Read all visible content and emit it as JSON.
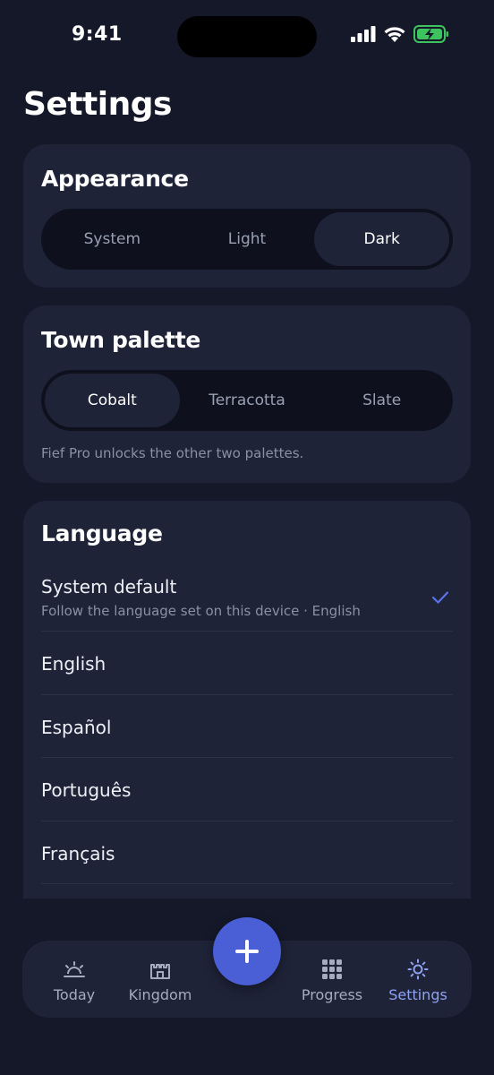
{
  "status": {
    "time": "9:41"
  },
  "page": {
    "title": "Settings"
  },
  "appearance": {
    "title": "Appearance",
    "options": [
      "System",
      "Light",
      "Dark"
    ],
    "selected": "Dark"
  },
  "palette": {
    "title": "Town palette",
    "options": [
      "Cobalt",
      "Terracotta",
      "Slate"
    ],
    "selected": "Cobalt",
    "hint": "Fief Pro unlocks the other two palettes."
  },
  "language": {
    "title": "Language",
    "items": [
      {
        "label": "System default",
        "sublabel": "Follow the language set on this device · English",
        "selected": true
      },
      {
        "label": "English"
      },
      {
        "label": "Español"
      },
      {
        "label": "Português"
      },
      {
        "label": "Français"
      }
    ]
  },
  "tabbar": {
    "tabs": [
      {
        "label": "Today",
        "icon": "sunrise-icon"
      },
      {
        "label": "Kingdom",
        "icon": "castle-icon"
      },
      {
        "label": "Progress",
        "icon": "grid-icon"
      },
      {
        "label": "Settings",
        "icon": "sun-gear-icon",
        "active": true
      }
    ],
    "fab_icon": "plus-icon"
  },
  "colors": {
    "background": "#141828",
    "card": "#1e2338",
    "accent": "#4a5fd6",
    "active_tab": "#8fa2f2"
  }
}
